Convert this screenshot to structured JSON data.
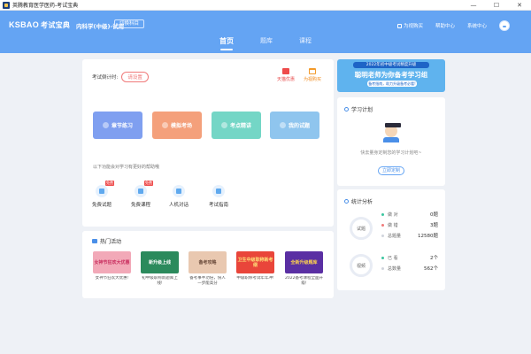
{
  "window": {
    "title": "英腾教育医学医药-考试宝典",
    "controls": {
      "minimize": "—",
      "maximize": "☐",
      "close": "✕"
    }
  },
  "header": {
    "logo_en": "KSBAO",
    "logo_cn": "考试宝典",
    "course_name": "内科学(中级)-试用",
    "switch_label": "切换科目",
    "links": {
      "bargain": "为视购买",
      "help": "帮助中心",
      "settings": "系统中心"
    }
  },
  "nav": {
    "tabs": [
      "首页",
      "题库",
      "课程"
    ],
    "active_index": 0
  },
  "main": {
    "exam_time_label": "考试倒计时:",
    "set_button": "请设置",
    "quick": {
      "bargain": "天猫优惠",
      "buy": "为视购买"
    },
    "features": [
      "章节练习",
      "模拟考场",
      "考点精讲",
      "我的试题"
    ],
    "hint": "以下功能会对学习有更好的帮助哦",
    "tools": [
      {
        "label": "免费试题",
        "badge": "免费"
      },
      {
        "label": "免费课程",
        "badge": "免费"
      },
      {
        "label": "人机对话",
        "badge": ""
      },
      {
        "label": "考试指南",
        "badge": ""
      }
    ]
  },
  "hot": {
    "title": "热门活动",
    "items": [
      {
        "thumb": "女神节狂欢大优惠",
        "caption": "女神节狂欢大优惠!"
      },
      {
        "thumb": "新升级上线",
        "caption": "初中级职称新题库上线!"
      },
      {
        "thumb": "备考攻略",
        "caption": "备考事半功倍，快人一步能高分"
      },
      {
        "thumb": "卫生中级职称新考纲",
        "caption": "中级职称考试年年冲!"
      },
      {
        "thumb": "全新升级题库",
        "caption": "2022备考课程全面升级!"
      }
    ]
  },
  "banner": {
    "line1": "2022年初中级考试精度升级",
    "line2": "聪明老师为你备考学习组",
    "line3": "备考指南，助力升级备考必看!"
  },
  "plan": {
    "title": "学习计划",
    "empty_text": "快去量身定制您的学习计划吧~",
    "button": "立即定制"
  },
  "stats": {
    "title": "统计分析",
    "ring1_label": "试题",
    "ring2_label": "视频",
    "rows": [
      {
        "label": "做 对",
        "value": "0题",
        "color": "#3cc6a0"
      },
      {
        "label": "做 错",
        "value": "3题",
        "color": "#f07a7a"
      },
      {
        "label": "总题量",
        "value": "12580题",
        "color": "#d0d4dc"
      },
      {
        "label": "已 看",
        "value": "2个",
        "color": "#3cc6a0"
      },
      {
        "label": "总数量",
        "value": "562个",
        "color": "#d0d4dc"
      }
    ]
  }
}
